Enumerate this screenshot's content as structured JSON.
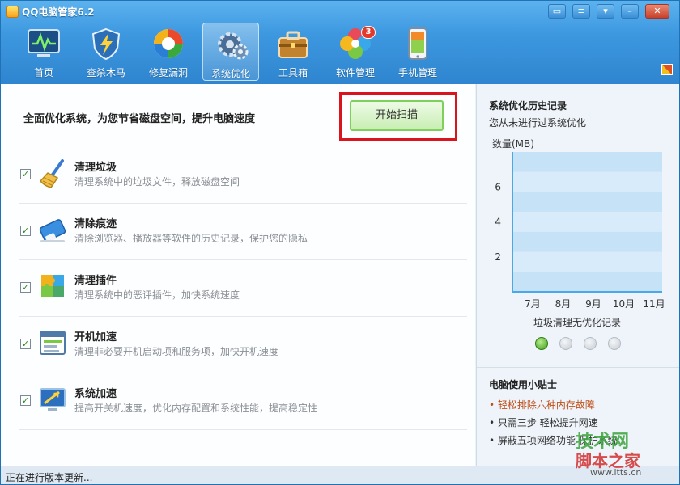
{
  "window": {
    "title": "QQ电脑管家6.2"
  },
  "nav": [
    {
      "label": "首页",
      "icon": "monitor-pulse-icon"
    },
    {
      "label": "查杀木马",
      "icon": "shield-lightning-icon"
    },
    {
      "label": "修复漏洞",
      "icon": "repair-circle-icon"
    },
    {
      "label": "系统优化",
      "icon": "gears-icon",
      "active": true
    },
    {
      "label": "工具箱",
      "icon": "toolbox-icon"
    },
    {
      "label": "软件管理",
      "icon": "software-petals-icon",
      "badge": "3"
    },
    {
      "label": "手机管理",
      "icon": "phone-icon"
    }
  ],
  "main": {
    "headline": "全面优化系统，为您节省磁盘空间，提升电脑速度",
    "scan_button": "开始扫描",
    "items": [
      {
        "title": "清理垃圾",
        "desc": "清理系统中的垃圾文件，释放磁盘空间",
        "checked": true,
        "icon": "broom-icon"
      },
      {
        "title": "清除痕迹",
        "desc": "清除浏览器、播放器等软件的历史记录，保护您的隐私",
        "checked": true,
        "icon": "eraser-icon"
      },
      {
        "title": "清理插件",
        "desc": "清理系统中的恶评插件，加快系统速度",
        "checked": true,
        "icon": "puzzle-icon"
      },
      {
        "title": "开机加速",
        "desc": "清理非必要开机启动项和服务项，加快开机速度",
        "checked": true,
        "icon": "startup-window-icon"
      },
      {
        "title": "系统加速",
        "desc": "提高开关机速度，优化内存配置和系统性能，提高稳定性",
        "checked": true,
        "icon": "speed-monitor-icon"
      }
    ],
    "checkmark": "✓"
  },
  "history": {
    "title": "系统优化历史记录",
    "subtitle": "您从未进行过系统优化",
    "caption": "垃圾清理无优化记录",
    "pager_count": 4,
    "pager_active": 0
  },
  "chart_data": {
    "type": "bar",
    "categories": [
      "7月",
      "8月",
      "9月",
      "10月",
      "11月"
    ],
    "values": [
      0,
      0,
      0,
      0,
      0
    ],
    "title": "",
    "xlabel": "",
    "ylabel": "数量(MB)",
    "yticks": [
      2,
      4,
      6
    ],
    "ylim": [
      0,
      8
    ],
    "grid": true
  },
  "tips": {
    "title": "电脑使用小贴士",
    "items": [
      {
        "text": "• 轻松排除六种内存故障",
        "hot": true
      },
      {
        "text": "• 只需三步 轻松提升网速",
        "hot": false
      },
      {
        "text": "• 屏蔽五项网络功能 保护系统",
        "hot": false
      }
    ]
  },
  "status": {
    "text": "正在进行版本更新..."
  },
  "watermark": {
    "line1": "技术网",
    "line2": "脚本之家",
    "line3": "www.itts.cn"
  },
  "colors": {
    "accent": "#3d98e0",
    "highlight_box": "#d9141c",
    "check": "#1d8a1d",
    "hot_tip": "#c0501a"
  }
}
